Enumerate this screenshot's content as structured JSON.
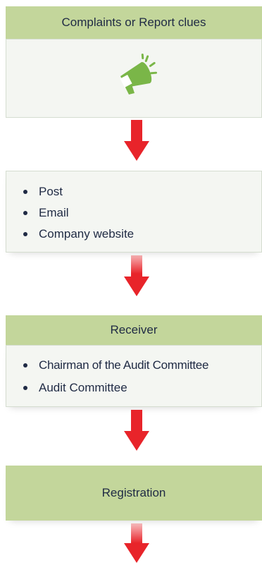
{
  "steps": [
    {
      "title": "Complaints or Report clues",
      "icon": "megaphone-icon"
    },
    {
      "channels": [
        "Post",
        "Email",
        "Company website"
      ]
    },
    {
      "title": "Receiver",
      "receivers": [
        "Chairman of the Audit Committee",
        "Audit Committee"
      ]
    },
    {
      "title": "Registration"
    }
  ],
  "colors": {
    "header": "#c3d69b",
    "body": "#f4f6f2",
    "arrow": "#e8242a",
    "icon": "#7ab648",
    "text": "#1f2a44"
  }
}
